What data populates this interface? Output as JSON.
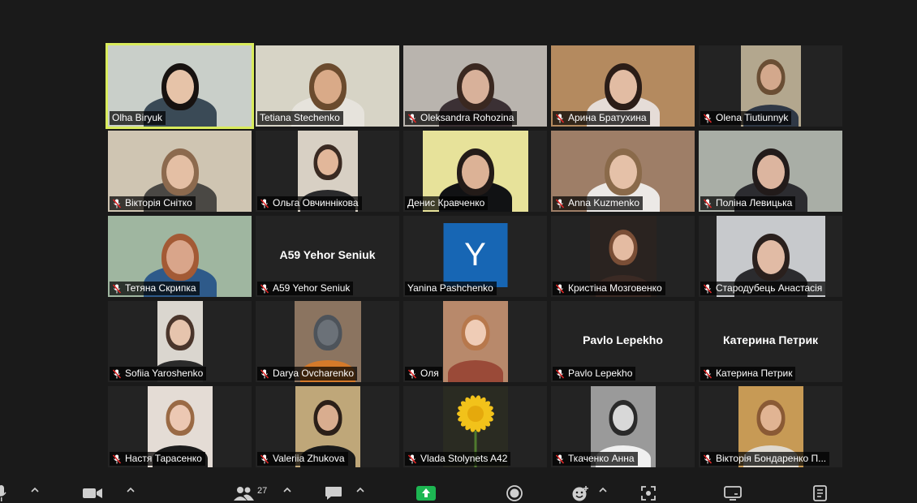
{
  "participants": [
    {
      "name": "Olha Biryuk",
      "muted": false,
      "speaking": true,
      "bg": "#c9cfc9",
      "skin": "#e6c3a8",
      "hair": "#171210",
      "shirt": "#3a4a56"
    },
    {
      "name": "Tetiana Stechenko",
      "muted": false,
      "bg": "#d7d4c6",
      "skin": "#d9aa88",
      "hair": "#6b4b2e",
      "shirt": "#e6e3dc"
    },
    {
      "name": "Oleksandra Rohozina",
      "muted": true,
      "bg": "#b9b4ae",
      "skin": "#d8b19a",
      "hair": "#3a2820",
      "shirt": "#3b3034"
    },
    {
      "name": "Арина Братухина",
      "muted": true,
      "bg": "#b48a5f",
      "skin": "#e2bca3",
      "hair": "#2b1d17",
      "shirt": "#e5dcd7"
    },
    {
      "name": "Olena Tiutiunnyk",
      "muted": true,
      "bg": "#b3a78e",
      "skin": "#d3a88c",
      "hair": "#6a4e34",
      "shirt": "#2f3846"
    },
    {
      "name": "Вікторія Снітко",
      "muted": true,
      "bg": "#cfc5b2",
      "skin": "#e4bfa4",
      "hair": "#8c6a4e",
      "shirt": "#4a4844"
    },
    {
      "name": "Ольга Овчиннікова",
      "muted": true,
      "bg": "#d8d0c4",
      "skin": "#e2b79a",
      "hair": "#3a2a22",
      "shirt": "#2a2a2c"
    },
    {
      "name": "Денис Кравченко",
      "muted": false,
      "bg": "#e7e29a",
      "skin": "#dcb296",
      "hair": "#231b18",
      "shirt": "#111214"
    },
    {
      "name": "Anna Kuzmenko",
      "muted": true,
      "bg": "#9e7e67",
      "skin": "#e5c1a8",
      "hair": "#8a6a4a",
      "shirt": "#ece9e6"
    },
    {
      "name": "Поліна Левицька",
      "muted": true,
      "bg": "#a9aea6",
      "skin": "#dcb59f",
      "hair": "#221b1a",
      "shirt": "#2c2c30"
    },
    {
      "name": "Тетяна Скрипка",
      "muted": true,
      "bg": "#9fb6a0",
      "skin": "#d9a58a",
      "hair": "#a35a35",
      "shirt": "#2e5a8a"
    },
    {
      "name": "A59 Yehor Seniuk",
      "muted": true,
      "video": false,
      "display": "A59 Yehor Seniuk"
    },
    {
      "name": "Yanina Pashchenko",
      "muted": false,
      "video": false,
      "avatar": "Y"
    },
    {
      "name": "Кристіна Мозговенко",
      "muted": true,
      "bg": "#2a2320",
      "skin": "#e4bba2",
      "hair": "#7a4e36",
      "shirt": "#3b2a24"
    },
    {
      "name": "Стародубець Анастасія",
      "muted": true,
      "bg": "#c7c9cc",
      "skin": "#e1bba5",
      "hair": "#2a201d",
      "shirt": "#2b2b2e"
    },
    {
      "name": "Sofiia Yaroshenko",
      "muted": true,
      "bg": "#dad6cf",
      "skin": "#e6c4ad",
      "hair": "#4a352b",
      "shirt": "#2b2b2b"
    },
    {
      "name": "Darya Ovcharenko",
      "muted": true,
      "bg": "#8b7460",
      "skin": "#6b7178",
      "hair": "#4d535a",
      "shirt": "#d57a2a"
    },
    {
      "name": "Оля",
      "muted": true,
      "bg": "#b8896b",
      "skin": "#efccb6",
      "hair": "#b7784c",
      "shirt": "#9a4a38"
    },
    {
      "name": "Pavlo Lepekho",
      "muted": true,
      "video": false,
      "display": "Pavlo Lepekho"
    },
    {
      "name": "Катерина Петрик",
      "muted": true,
      "video": false,
      "display": "Катерина Петрик"
    },
    {
      "name": "Настя Тарасенко",
      "muted": true,
      "bg": "#e4dcd5",
      "skin": "#ecc8b3",
      "hair": "#9a6a45",
      "shirt": "#1c1c1c"
    },
    {
      "name": "Valeriia Zhukova",
      "muted": true,
      "bg": "#bfa779",
      "skin": "#d9ad8f",
      "hair": "#2b1f18",
      "shirt": "#1a1a1a"
    },
    {
      "name": "Vlada Stolynets A42",
      "muted": true,
      "flower": true,
      "bg": "#2a2b22"
    },
    {
      "name": "Ткаченко Анна",
      "muted": true,
      "bw": true,
      "bg": "#9a9a9a",
      "skin": "#d8d8d8",
      "hair": "#2a2a2a",
      "shirt": "#f0f0f0"
    },
    {
      "name": "Вікторія Бондаренко П...",
      "muted": true,
      "bg": "#c79a55",
      "skin": "#e1b493",
      "hair": "#8a5a35",
      "shirt": "#dfd9cf"
    }
  ],
  "toolbar": {
    "participants_count": "27",
    "colors": {
      "share": "#1db652",
      "icon": "#cfcfcf"
    }
  }
}
